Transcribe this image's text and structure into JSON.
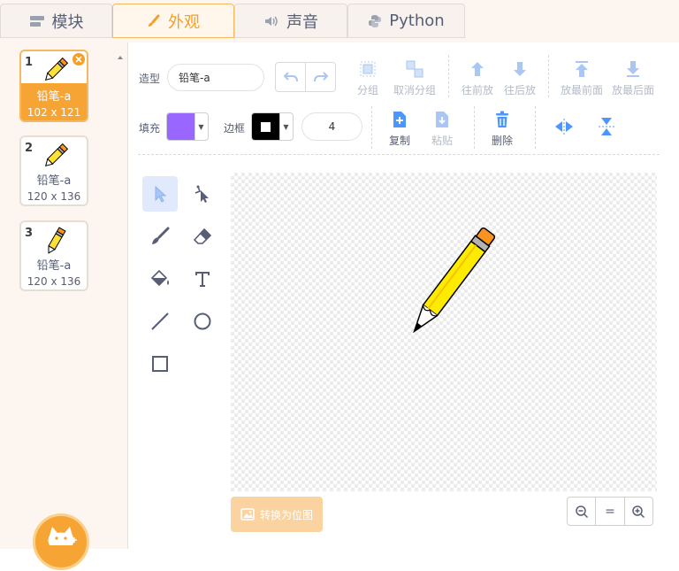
{
  "tabs": [
    {
      "label": "模块",
      "icon": "blocks-icon",
      "active": false
    },
    {
      "label": "外观",
      "icon": "brush-icon",
      "active": true
    },
    {
      "label": "声音",
      "icon": "speaker-icon",
      "active": false
    },
    {
      "label": "Python",
      "icon": "python-icon",
      "active": false
    }
  ],
  "costumes": [
    {
      "number": "1",
      "name": "铅笔-a",
      "size": "102 x 121",
      "selected": true
    },
    {
      "number": "2",
      "name": "铅笔-a",
      "size": "120 x 136",
      "selected": false
    },
    {
      "number": "3",
      "name": "铅笔-a",
      "size": "120 x 136",
      "selected": false
    }
  ],
  "toolbar": {
    "costume_label": "造型",
    "costume_name": "铅笔-a",
    "group": "分组",
    "ungroup": "取消分组",
    "forward": "往前放",
    "backward": "往后放",
    "front": "放最前面",
    "back": "放最后面",
    "fill_label": "填充",
    "fill_color": "#9966ff",
    "outline_label": "边框",
    "outline_color": "#000000",
    "outline_width": "4",
    "copy": "复制",
    "paste": "粘贴",
    "delete": "删除"
  },
  "convert_bitmap": "转换为位图",
  "zoom": {
    "out": "−",
    "reset": "=",
    "in": "+"
  },
  "colors": {
    "accent": "#f49f25",
    "tool_blue": "#4c97ff",
    "disabled": "#b3bac6"
  }
}
